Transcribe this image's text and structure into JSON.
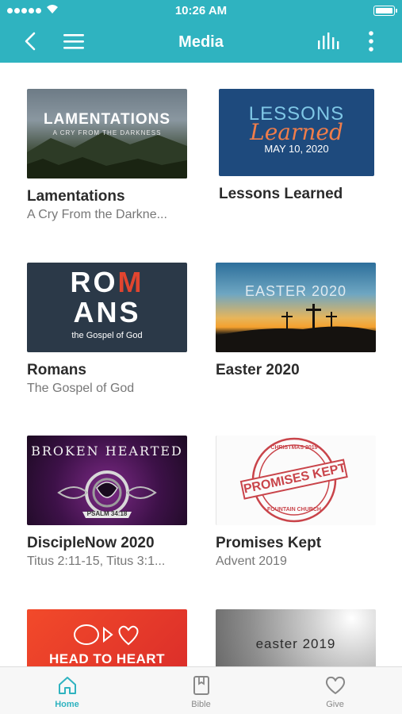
{
  "status_bar": {
    "time": "10:26 AM"
  },
  "header": {
    "title": "Media"
  },
  "media": [
    {
      "title": "Lamentations",
      "subtitle": "A Cry From the Darkne...",
      "art_line1": "LAMENTATIONS",
      "art_line2": "A CRY FROM THE DARKNESS"
    },
    {
      "title": "Lessons Learned",
      "subtitle": "",
      "art_line1": "LESSONS",
      "art_line2": "Learned",
      "art_line3": "MAY 10, 2020"
    },
    {
      "title": "Romans",
      "subtitle": "The Gospel of God",
      "art_line1": "ROM",
      "art_line2": "ANS",
      "art_line3": "the Gospel of God"
    },
    {
      "title": "Easter 2020",
      "subtitle": "",
      "art_line1": "EASTER 2020"
    },
    {
      "title": "DiscipleNow 2020",
      "subtitle": "Titus 2:11-15, Titus 3:1...",
      "art_line1": "BROKEN HEARTED",
      "art_line2": "PSALM 34:18"
    },
    {
      "title": "Promises Kept",
      "subtitle": "Advent 2019",
      "art_line1": "CHRISTMAS 2019",
      "art_line2": "PROMISES KEPT",
      "art_line3": "FOUNTAIN CHURCH"
    },
    {
      "title": "",
      "subtitle": "",
      "art_line1": "HEAD TO HEART"
    },
    {
      "title": "",
      "subtitle": "",
      "art_line1": "easter 2019"
    }
  ],
  "tabs": [
    {
      "label": "Home",
      "icon": "home-icon",
      "active": true
    },
    {
      "label": "Bible",
      "icon": "book-icon",
      "active": false
    },
    {
      "label": "Give",
      "icon": "heart-icon",
      "active": false
    }
  ],
  "colors": {
    "accent": "#2fb3c0",
    "romans_red": "#e2452f",
    "head_to_heart_red": "#e8352a"
  }
}
